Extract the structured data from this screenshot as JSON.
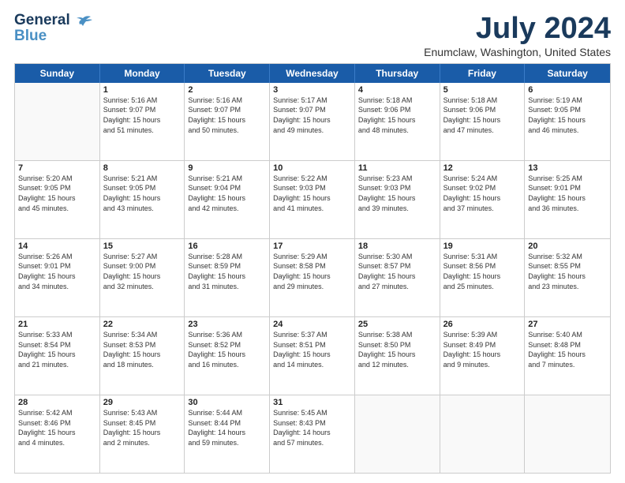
{
  "logo": {
    "line1": "General",
    "line2": "Blue"
  },
  "title": "July 2024",
  "location": "Enumclaw, Washington, United States",
  "weekdays": [
    "Sunday",
    "Monday",
    "Tuesday",
    "Wednesday",
    "Thursday",
    "Friday",
    "Saturday"
  ],
  "weeks": [
    [
      {
        "day": "",
        "info": ""
      },
      {
        "day": "1",
        "info": "Sunrise: 5:16 AM\nSunset: 9:07 PM\nDaylight: 15 hours\nand 51 minutes."
      },
      {
        "day": "2",
        "info": "Sunrise: 5:16 AM\nSunset: 9:07 PM\nDaylight: 15 hours\nand 50 minutes."
      },
      {
        "day": "3",
        "info": "Sunrise: 5:17 AM\nSunset: 9:07 PM\nDaylight: 15 hours\nand 49 minutes."
      },
      {
        "day": "4",
        "info": "Sunrise: 5:18 AM\nSunset: 9:06 PM\nDaylight: 15 hours\nand 48 minutes."
      },
      {
        "day": "5",
        "info": "Sunrise: 5:18 AM\nSunset: 9:06 PM\nDaylight: 15 hours\nand 47 minutes."
      },
      {
        "day": "6",
        "info": "Sunrise: 5:19 AM\nSunset: 9:05 PM\nDaylight: 15 hours\nand 46 minutes."
      }
    ],
    [
      {
        "day": "7",
        "info": "Sunrise: 5:20 AM\nSunset: 9:05 PM\nDaylight: 15 hours\nand 45 minutes."
      },
      {
        "day": "8",
        "info": "Sunrise: 5:21 AM\nSunset: 9:05 PM\nDaylight: 15 hours\nand 43 minutes."
      },
      {
        "day": "9",
        "info": "Sunrise: 5:21 AM\nSunset: 9:04 PM\nDaylight: 15 hours\nand 42 minutes."
      },
      {
        "day": "10",
        "info": "Sunrise: 5:22 AM\nSunset: 9:03 PM\nDaylight: 15 hours\nand 41 minutes."
      },
      {
        "day": "11",
        "info": "Sunrise: 5:23 AM\nSunset: 9:03 PM\nDaylight: 15 hours\nand 39 minutes."
      },
      {
        "day": "12",
        "info": "Sunrise: 5:24 AM\nSunset: 9:02 PM\nDaylight: 15 hours\nand 37 minutes."
      },
      {
        "day": "13",
        "info": "Sunrise: 5:25 AM\nSunset: 9:01 PM\nDaylight: 15 hours\nand 36 minutes."
      }
    ],
    [
      {
        "day": "14",
        "info": "Sunrise: 5:26 AM\nSunset: 9:01 PM\nDaylight: 15 hours\nand 34 minutes."
      },
      {
        "day": "15",
        "info": "Sunrise: 5:27 AM\nSunset: 9:00 PM\nDaylight: 15 hours\nand 32 minutes."
      },
      {
        "day": "16",
        "info": "Sunrise: 5:28 AM\nSunset: 8:59 PM\nDaylight: 15 hours\nand 31 minutes."
      },
      {
        "day": "17",
        "info": "Sunrise: 5:29 AM\nSunset: 8:58 PM\nDaylight: 15 hours\nand 29 minutes."
      },
      {
        "day": "18",
        "info": "Sunrise: 5:30 AM\nSunset: 8:57 PM\nDaylight: 15 hours\nand 27 minutes."
      },
      {
        "day": "19",
        "info": "Sunrise: 5:31 AM\nSunset: 8:56 PM\nDaylight: 15 hours\nand 25 minutes."
      },
      {
        "day": "20",
        "info": "Sunrise: 5:32 AM\nSunset: 8:55 PM\nDaylight: 15 hours\nand 23 minutes."
      }
    ],
    [
      {
        "day": "21",
        "info": "Sunrise: 5:33 AM\nSunset: 8:54 PM\nDaylight: 15 hours\nand 21 minutes."
      },
      {
        "day": "22",
        "info": "Sunrise: 5:34 AM\nSunset: 8:53 PM\nDaylight: 15 hours\nand 18 minutes."
      },
      {
        "day": "23",
        "info": "Sunrise: 5:36 AM\nSunset: 8:52 PM\nDaylight: 15 hours\nand 16 minutes."
      },
      {
        "day": "24",
        "info": "Sunrise: 5:37 AM\nSunset: 8:51 PM\nDaylight: 15 hours\nand 14 minutes."
      },
      {
        "day": "25",
        "info": "Sunrise: 5:38 AM\nSunset: 8:50 PM\nDaylight: 15 hours\nand 12 minutes."
      },
      {
        "day": "26",
        "info": "Sunrise: 5:39 AM\nSunset: 8:49 PM\nDaylight: 15 hours\nand 9 minutes."
      },
      {
        "day": "27",
        "info": "Sunrise: 5:40 AM\nSunset: 8:48 PM\nDaylight: 15 hours\nand 7 minutes."
      }
    ],
    [
      {
        "day": "28",
        "info": "Sunrise: 5:42 AM\nSunset: 8:46 PM\nDaylight: 15 hours\nand 4 minutes."
      },
      {
        "day": "29",
        "info": "Sunrise: 5:43 AM\nSunset: 8:45 PM\nDaylight: 15 hours\nand 2 minutes."
      },
      {
        "day": "30",
        "info": "Sunrise: 5:44 AM\nSunset: 8:44 PM\nDaylight: 14 hours\nand 59 minutes."
      },
      {
        "day": "31",
        "info": "Sunrise: 5:45 AM\nSunset: 8:43 PM\nDaylight: 14 hours\nand 57 minutes."
      },
      {
        "day": "",
        "info": ""
      },
      {
        "day": "",
        "info": ""
      },
      {
        "day": "",
        "info": ""
      }
    ]
  ]
}
